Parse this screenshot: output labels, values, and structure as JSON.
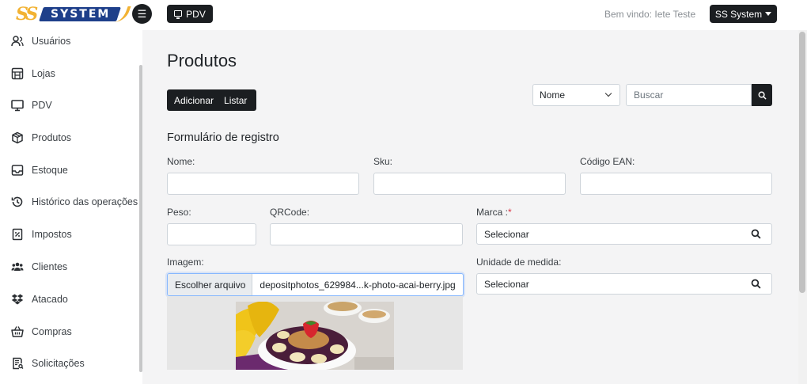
{
  "header": {
    "logo_text": "SYSTEM",
    "logo_mark": "SS",
    "menu_icon": "hamburger-icon",
    "pdv_label": "PDV",
    "welcome": "Bem vindo: Iete Teste",
    "account_label": "SS System"
  },
  "sidebar": {
    "items": [
      {
        "label": "Usuários",
        "icon": "users-icon"
      },
      {
        "label": "Lojas",
        "icon": "store-icon"
      },
      {
        "label": "PDV",
        "icon": "monitor-icon"
      },
      {
        "label": "Produtos",
        "icon": "box-icon"
      },
      {
        "label": "Estoque",
        "icon": "inbox-icon"
      },
      {
        "label": "Histórico das operações",
        "icon": "history-icon"
      },
      {
        "label": "Impostos",
        "icon": "receipt-icon"
      },
      {
        "label": "Clientes",
        "icon": "clients-icon"
      },
      {
        "label": "Atacado",
        "icon": "dropbox-icon"
      },
      {
        "label": "Compras",
        "icon": "basket-icon"
      },
      {
        "label": "Solicitações",
        "icon": "request-icon"
      }
    ]
  },
  "main": {
    "title": "Produtos",
    "actions": {
      "add": "Adicionar",
      "list": "Listar"
    },
    "filter": {
      "selected": "Nome",
      "search_placeholder": "Buscar"
    },
    "form": {
      "title": "Formulário de registro",
      "nome_label": "Nome:",
      "sku_label": "Sku:",
      "ean_label": "Código EAN:",
      "peso_label": "Peso:",
      "qrcode_label": "QRCode:",
      "marca_label": "Marca :",
      "marca_required": "*",
      "marca_value": "Selecionar",
      "imagem_label": "Imagem:",
      "file_button": "Escolher arquivo",
      "file_name": "depositphotos_629984...k-photo-acai-berry.jpg",
      "unidade_label": "Unidade de medida:",
      "unidade_value": "Selecionar"
    }
  },
  "colors": {
    "dark": "#1b1e21",
    "main_bg": "#f4f4f5",
    "logo_blue": "#1e3f8a",
    "logo_gold": "#f2b233",
    "required": "#dc3545"
  }
}
